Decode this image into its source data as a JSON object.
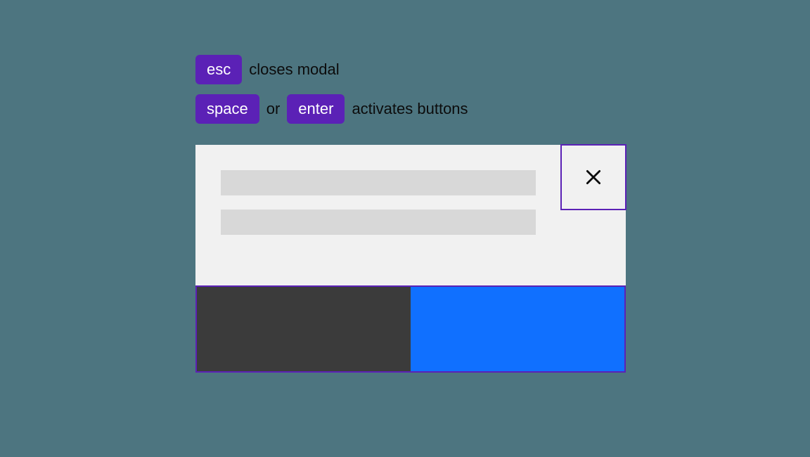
{
  "legend": {
    "items": [
      {
        "keys": [
          "esc"
        ],
        "description": "closes modal"
      },
      {
        "keys": [
          "space",
          "enter"
        ],
        "separator": "or",
        "description": "activates buttons"
      }
    ]
  },
  "modal": {
    "close_icon_name": "close-icon",
    "highlighted_elements": [
      "close-button",
      "cancel-button",
      "confirm-button"
    ],
    "highlight_color": "#5b21b6",
    "buttons": {
      "cancel_color": "#3b3b3b",
      "confirm_color": "#1070ff"
    }
  }
}
